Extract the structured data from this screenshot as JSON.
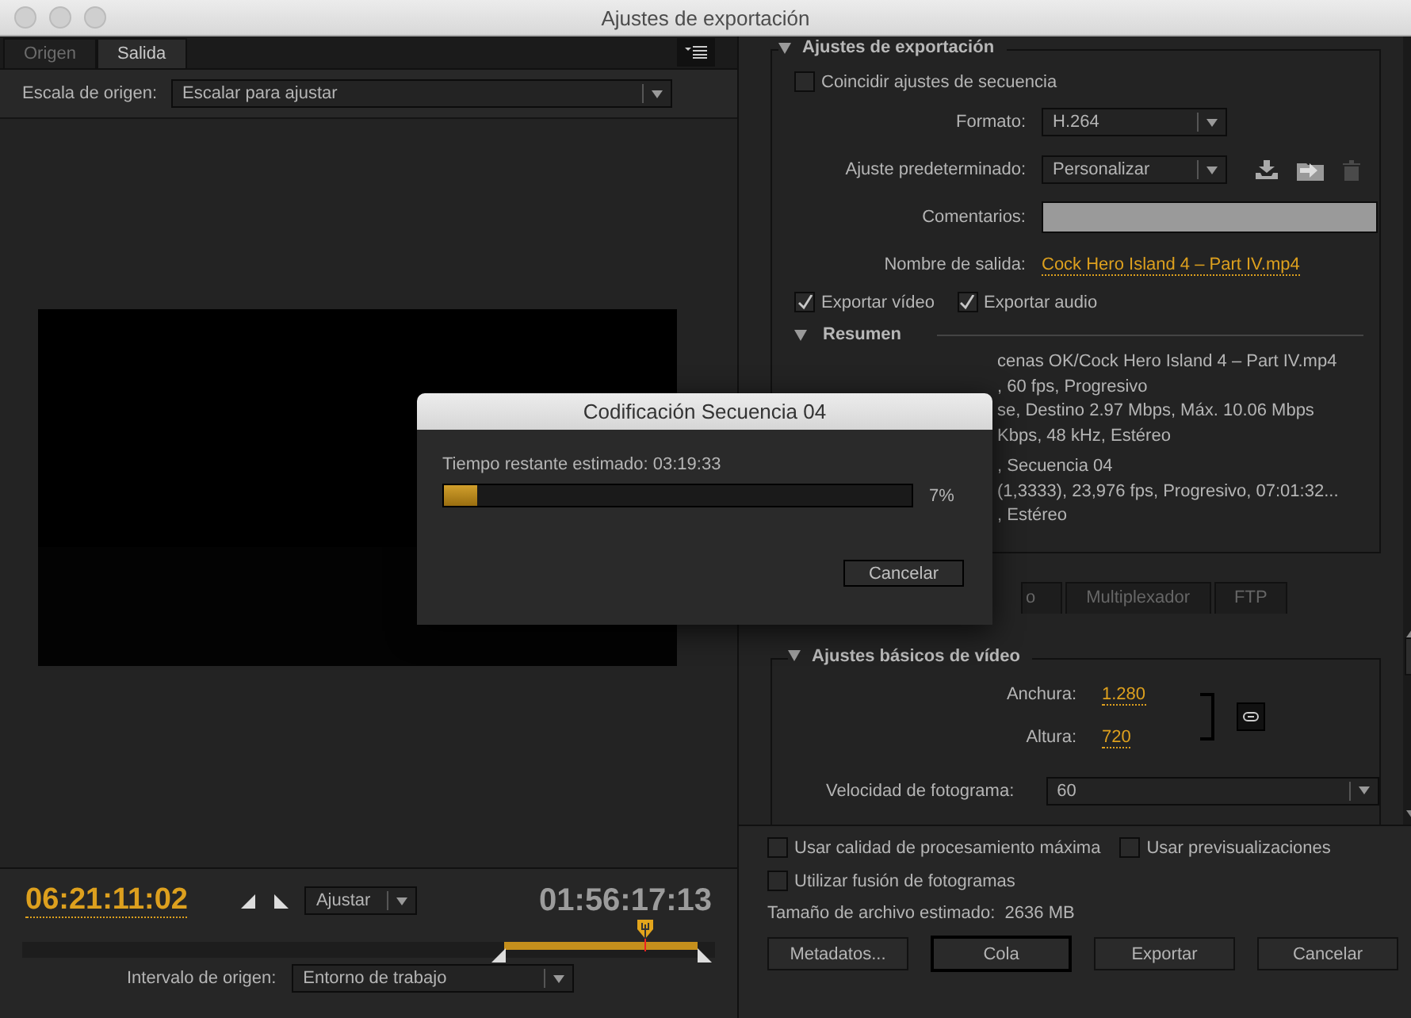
{
  "window": {
    "title": "Ajustes de exportación"
  },
  "left": {
    "tabs": [
      {
        "label": "Origen",
        "selected": false
      },
      {
        "label": "Salida",
        "selected": true
      }
    ],
    "source_scale": {
      "label": "Escala de origen:",
      "value": "Escalar para ajustar"
    },
    "timeline": {
      "current_time": "06:21:11:02",
      "zoom": "Ajustar",
      "duration": "01:56:17:13",
      "level": 0.9
    },
    "source_range": {
      "label": "Intervalo de origen:",
      "value": "Entorno de trabajo"
    }
  },
  "export_settings": {
    "title": "Ajustes de exportación",
    "match_sequence": {
      "label": "Coincidir ajustes de secuencia",
      "checked": false
    },
    "fields": [
      {
        "label": "Formato:",
        "kind": "dropdown",
        "value": "H.264"
      },
      {
        "label": "Ajuste predeterminado:",
        "kind": "preset",
        "value": "Personalizar"
      },
      {
        "label": "Comentarios:",
        "kind": "text"
      },
      {
        "label": "Nombre de salida:",
        "kind": "link",
        "value": "Cock Hero Island 4 – Part IV.mp4"
      }
    ],
    "exports": [
      {
        "label": "Exportar vídeo",
        "checked": true
      },
      {
        "label": "Exportar audio",
        "checked": true
      }
    ],
    "summary": {
      "title": "Resumen",
      "groups": [
        [
          "cenas OK/Cock Hero Island 4 – Part IV.mp4",
          ", 60 fps, Progresivo",
          "se, Destino 2.97 Mbps, Máx. 10.06 Mbps",
          "Kbps, 48 kHz, Estéreo"
        ],
        [
          ", Secuencia 04",
          "(1,3333), 23,976 fps, Progresivo, 07:01:32...",
          ", Estéreo"
        ]
      ]
    }
  },
  "tabs": [
    {
      "label": "o",
      "selected": false
    },
    {
      "label": "Multiplexador",
      "selected": false
    },
    {
      "label": "FTP",
      "selected": false
    }
  ],
  "video_basic": {
    "title": "Ajustes básicos de vídeo",
    "width": {
      "label": "Anchura:",
      "value": "1.280"
    },
    "height": {
      "label": "Altura:",
      "value": "720"
    },
    "frame_rate": {
      "label": "Velocidad de fotograma:",
      "value": "60"
    }
  },
  "options": [
    {
      "label": "Usar calidad de procesamiento máxima",
      "checked": false
    },
    {
      "label": "Usar previsualizaciones",
      "checked": false
    },
    {
      "label": "Utilizar fusión de fotogramas",
      "checked": false
    }
  ],
  "file_size": "Tamaño de archivo estimado:  2636 MB",
  "buttons": [
    {
      "label": "Metadatos...",
      "focused": false
    },
    {
      "label": "Cola",
      "focused": true
    },
    {
      "label": "Exportar",
      "focused": false
    },
    {
      "label": "Cancelar",
      "focused": false
    }
  ],
  "dialog": {
    "title": "Codificación Secuencia 04",
    "status": "Tiempo restante estimado: 03:19:33",
    "level": 0.07,
    "percent": "7%",
    "button": "Cancelar"
  }
}
